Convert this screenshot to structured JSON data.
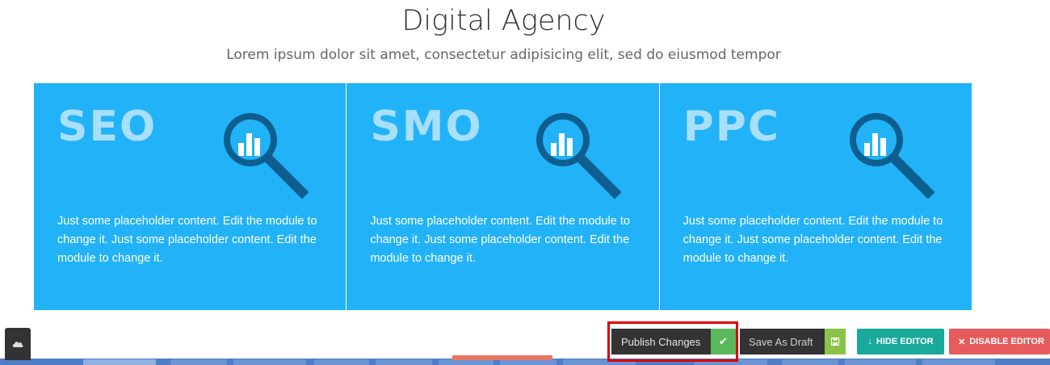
{
  "hero": {
    "title": "Digital Agency",
    "subtitle": "Lorem ipsum dolor sit amet, consectetur adipisicing elit, sed do eiusmod tempor"
  },
  "cards": [
    {
      "title": "SEO",
      "text": "Just some placeholder content. Edit the module to change it. Just some placeholder content. Edit the module to change it.",
      "icon": "magnifier-chart-icon"
    },
    {
      "title": "SMO",
      "text": "Just some placeholder content. Edit the module to change it. Just some placeholder content. Edit the module to change it.",
      "icon": "magnifier-chart-icon"
    },
    {
      "title": "PPC",
      "text": "Just some placeholder content. Edit the module to change it. Just some placeholder content. Edit the module to change it.",
      "icon": "magnifier-chart-icon"
    }
  ],
  "toolbar": {
    "publish_label": "Publish Changes",
    "draft_label": "Save As Draft",
    "hide_editor_label": "HIDE EDITOR",
    "disable_editor_label": "DISABLE EDITOR"
  },
  "colors": {
    "card_bg": "#22b2f8",
    "card_title": "#a8dffb",
    "icon_dark": "#0e5f8f",
    "publish_check": "#5cb85c",
    "hide_editor": "#1aaa9c",
    "disable_editor": "#e65c5c",
    "highlight": "#e00000"
  }
}
